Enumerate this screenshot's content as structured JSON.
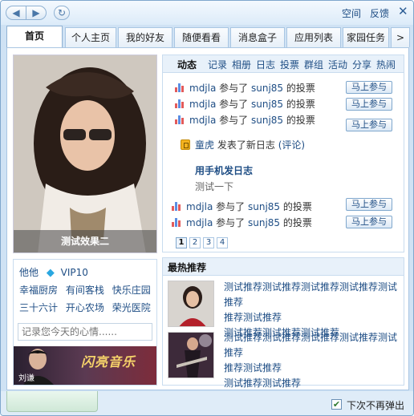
{
  "toolbar": {
    "back_icon": "arrow-left-icon",
    "forward_icon": "arrow-right-icon",
    "refresh_icon": "refresh-icon",
    "space_link": "空间",
    "feedback_link": "反馈",
    "close_icon": "close-icon"
  },
  "tabs": [
    {
      "label": "首页",
      "active": true
    },
    {
      "label": "个人主页"
    },
    {
      "label": "我的好友"
    },
    {
      "label": "随便看看"
    },
    {
      "label": "消息盒子"
    },
    {
      "label": "应用列表"
    },
    {
      "label": "家园任务"
    },
    {
      "label": ">"
    }
  ],
  "profile": {
    "caption": "测试效果二",
    "nickname": "他他",
    "vip_icon": "diamond-icon",
    "vip": "VIP10",
    "apps_row1": [
      "幸福厨房",
      "有间客栈",
      "快乐庄园"
    ],
    "apps_row2": [
      "三十六计",
      "开心农场",
      "荣光医院"
    ],
    "mood_placeholder": "记录您今天的心情......",
    "banner_name": "刘谦",
    "banner_logo": "闪亮音乐"
  },
  "feed": {
    "tabs": [
      "动态",
      "记录",
      "相册",
      "日志",
      "投票",
      "群组",
      "活动",
      "分享",
      "热闹"
    ],
    "vote_items": [
      {
        "user": "mdjla",
        "verb": "参与了",
        "target": "sunj85",
        "suffix": "的投票",
        "button": "马上参与"
      },
      {
        "user": "mdjla",
        "verb": "参与了",
        "target": "sunj85",
        "suffix": "的投票",
        "button": "马上参与"
      },
      {
        "user": "mdjla",
        "verb": "参与了",
        "target": "sunj85",
        "suffix": "的投票",
        "button": "马上参与"
      }
    ],
    "blog_item": {
      "user": "童虎",
      "text": "发表了新日志",
      "link": "(评论)"
    },
    "blog_title": "用手机发日志",
    "blog_body": "测试一下",
    "vote_items_2": [
      {
        "user": "mdjla",
        "verb": "参与了",
        "target": "sunj85",
        "suffix": "的投票",
        "button": "马上参与"
      },
      {
        "user": "mdjla",
        "verb": "参与了",
        "target": "sunj85",
        "suffix": "的投票",
        "button": "马上参与"
      }
    ],
    "pages": [
      "1",
      "2",
      "3",
      "4"
    ]
  },
  "recommend": {
    "title": "最热推荐",
    "items": [
      {
        "lines": [
          "测试推荐测试推荐测试推荐测试推荐测试推荐",
          "推荐测试推荐",
          "测试推荐测试推荐测试推荐"
        ]
      },
      {
        "lines": [
          "测试推荐测试推荐测试推荐测试推荐测试推荐",
          "推荐测试推荐",
          "测试推荐测试推荐"
        ]
      }
    ]
  },
  "footer": {
    "checkbox_mark": "✔",
    "checkbox_label": "下次不再弹出"
  }
}
